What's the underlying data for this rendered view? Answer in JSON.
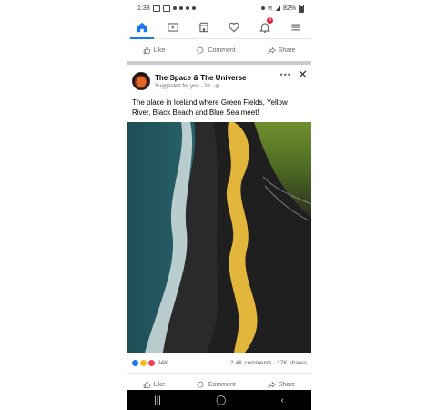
{
  "status_bar": {
    "time": "1:33",
    "battery": "82%"
  },
  "nav": {
    "items": [
      "home-icon",
      "video-icon",
      "marketplace-icon",
      "heart-icon",
      "notifications-icon",
      "menu-icon"
    ],
    "active": "home",
    "notification_count": "9",
    "accent": "#1877f2"
  },
  "top_actions": {
    "like": "Like",
    "comment": "Comment",
    "share": "Share"
  },
  "post": {
    "page_name": "The Space & The Universe",
    "subtitle": "Suggested for you · 2d · ",
    "text": "The place in Iceland where Green Fields, Yellow River, Black Beach and Blue Sea meet!",
    "reaction_count": "94K",
    "comments_shares": "2.4K comments · 17K shares"
  },
  "bottom_actions": {
    "like": "Like",
    "comment": "Comment",
    "share": "Share"
  }
}
